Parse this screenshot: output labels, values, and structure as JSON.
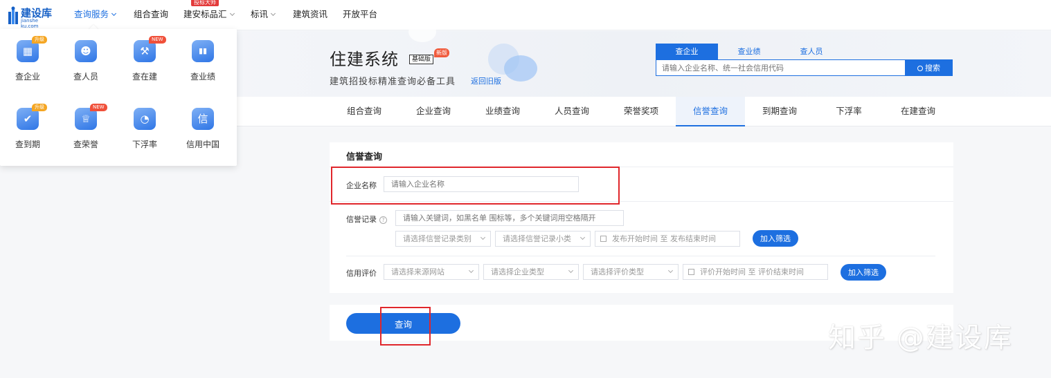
{
  "logo": {
    "name": "建设库",
    "domain": "jianshe ku.com"
  },
  "nav": {
    "items": [
      {
        "label": "查询服务",
        "active": true,
        "has_dropdown": true
      },
      {
        "label": "组合查询",
        "active": false,
        "has_dropdown": false
      },
      {
        "label": "建安标品汇",
        "active": false,
        "has_dropdown": true
      },
      {
        "label": "标讯",
        "active": false,
        "has_dropdown": true
      },
      {
        "label": "建筑资讯",
        "active": false,
        "has_dropdown": false
      },
      {
        "label": "开放平台",
        "active": false,
        "has_dropdown": false
      }
    ],
    "hot_badge": "投标大师"
  },
  "mega_menu": {
    "items": [
      {
        "label": "查企业",
        "icon": "company-icon",
        "glyph": "▦",
        "badge": "升级",
        "badge_type": "up"
      },
      {
        "label": "查人员",
        "icon": "people-icon",
        "glyph": "☻",
        "badge": "",
        "badge_type": ""
      },
      {
        "label": "查在建",
        "icon": "construction-icon",
        "glyph": "⚒",
        "badge": "NEW",
        "badge_type": "new"
      },
      {
        "label": "查业绩",
        "icon": "bar-chart-icon",
        "glyph": "▮▮",
        "badge": "",
        "badge_type": ""
      },
      {
        "label": "查到期",
        "icon": "calendar-check-icon",
        "glyph": "✔",
        "badge": "升级",
        "badge_type": "up"
      },
      {
        "label": "查荣誉",
        "icon": "trophy-icon",
        "glyph": "♕",
        "badge": "NEW",
        "badge_type": "new"
      },
      {
        "label": "下浮率",
        "icon": "pie-chart-icon",
        "glyph": "◔",
        "badge": "",
        "badge_type": ""
      },
      {
        "label": "信用中国",
        "icon": "credit-icon",
        "glyph": "信",
        "badge": "",
        "badge_type": ""
      }
    ]
  },
  "banner": {
    "title": "住建系统",
    "basic_tag": "基础版",
    "new_tag": "新版",
    "subtitle": "建筑招投标精准查询必备工具",
    "back_link": "返回旧版"
  },
  "search": {
    "tabs": [
      {
        "label": "查企业",
        "active": true
      },
      {
        "label": "查业绩",
        "active": false
      },
      {
        "label": "查人员",
        "active": false
      }
    ],
    "placeholder": "请输入企业名称、统一社会信用代码",
    "button": "搜索"
  },
  "subtabs": [
    {
      "label": "组合查询",
      "active": false
    },
    {
      "label": "企业查询",
      "active": false
    },
    {
      "label": "业绩查询",
      "active": false
    },
    {
      "label": "人员查询",
      "active": false
    },
    {
      "label": "荣誉奖项",
      "active": false
    },
    {
      "label": "信誉查询",
      "active": true
    },
    {
      "label": "到期查询",
      "active": false
    },
    {
      "label": "下浮率",
      "active": false
    },
    {
      "label": "在建查询",
      "active": false
    }
  ],
  "form": {
    "title": "信誉查询",
    "company": {
      "label": "企业名称",
      "placeholder": "请输入企业名称"
    },
    "credit_record": {
      "label": "信誉记录",
      "help": "?",
      "keyword_placeholder": "请输入关键词，如黑名单 围标等，多个关键词用空格隔开",
      "category_select": "请选择信誉记录类别",
      "subcategory_select": "请选择信誉记录小类",
      "date_range": "发布开始时间  至  发布结束时间",
      "add_filter": "加入筛选"
    },
    "credit_rating": {
      "label": "信用评价",
      "source_select": "请选择来源网站",
      "company_type_select": "请选择企业类型",
      "rating_type_select": "请选择评价类型",
      "date_range": "评价开始时间 至 评价结束时间",
      "add_filter": "加入筛选"
    },
    "submit": "查询"
  },
  "watermark": "知乎 @建设库",
  "colors": {
    "primary": "#1d6fe0",
    "highlight": "#e0262b"
  }
}
